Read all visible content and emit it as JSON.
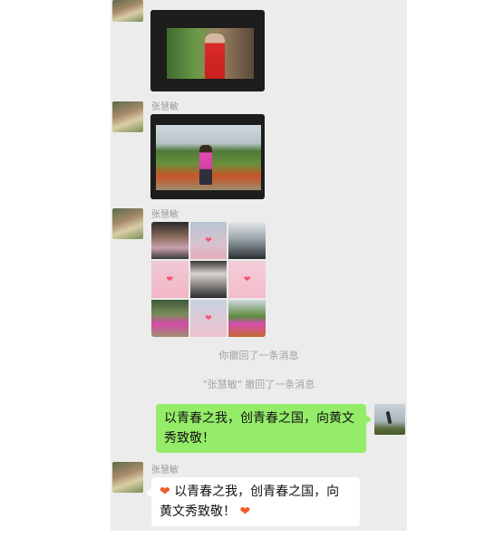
{
  "messages": {
    "sender_name_1": "张慧敏",
    "sender_name_2": "张慧敏",
    "sender_name_3": "张慧敏"
  },
  "system": {
    "recall_self": "你撤回了一条消息",
    "recall_other": "\"张慧敏\" 撤回了一条消息"
  },
  "sent_message": {
    "text": "以青春之我，创青春之国，向黄文秀致敬！"
  },
  "received_message": {
    "heart": "❤",
    "text": "以青春之我，创青春之国，向黄文秀致敬！"
  },
  "colors": {
    "chat_background": "#ececec",
    "sent_bubble": "#95ec69",
    "received_bubble": "#ffffff",
    "system_text": "#a3a3a3"
  },
  "icons": [
    "avatar",
    "photo-thumbnail",
    "heart-emoji"
  ]
}
